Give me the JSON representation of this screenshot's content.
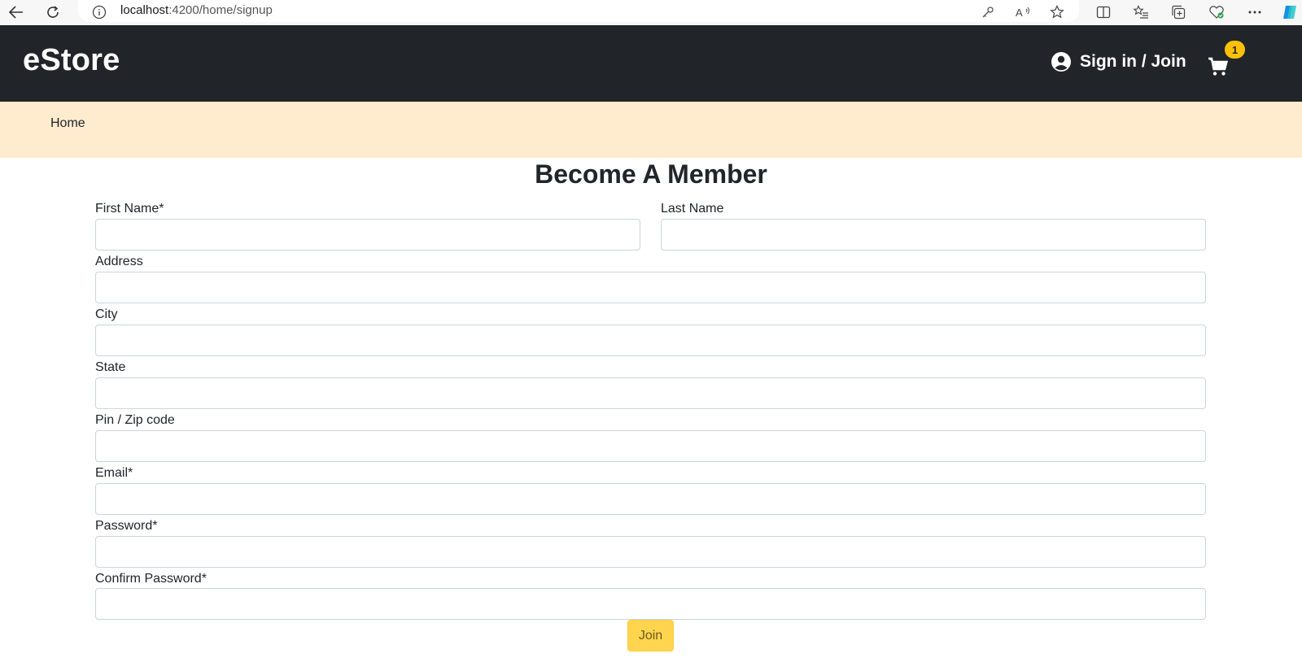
{
  "browser": {
    "url_host": "localhost",
    "url_path": ":4200/home/signup"
  },
  "navbar": {
    "brand": "eStore",
    "signin_label": "Sign in / Join",
    "cart_count": "1"
  },
  "breadcrumb": {
    "home": "Home"
  },
  "form": {
    "title": "Become A Member",
    "first_name_label": "First Name*",
    "last_name_label": "Last Name",
    "address_label": "Address",
    "city_label": "City",
    "state_label": "State",
    "pin_label": "Pin / Zip code",
    "email_label": "Email*",
    "password_label": "Password*",
    "confirm_password_label": "Confirm Password*",
    "first_name_value": "",
    "last_name_value": "",
    "address_value": "",
    "city_value": "",
    "state_value": "",
    "pin_value": "",
    "email_value": "",
    "password_value": "",
    "confirm_password_value": "",
    "join_label": "Join"
  },
  "colors": {
    "navbar_bg": "#212529",
    "breadcrumb_bg": "#ffebcd",
    "accent": "#ffc107"
  }
}
